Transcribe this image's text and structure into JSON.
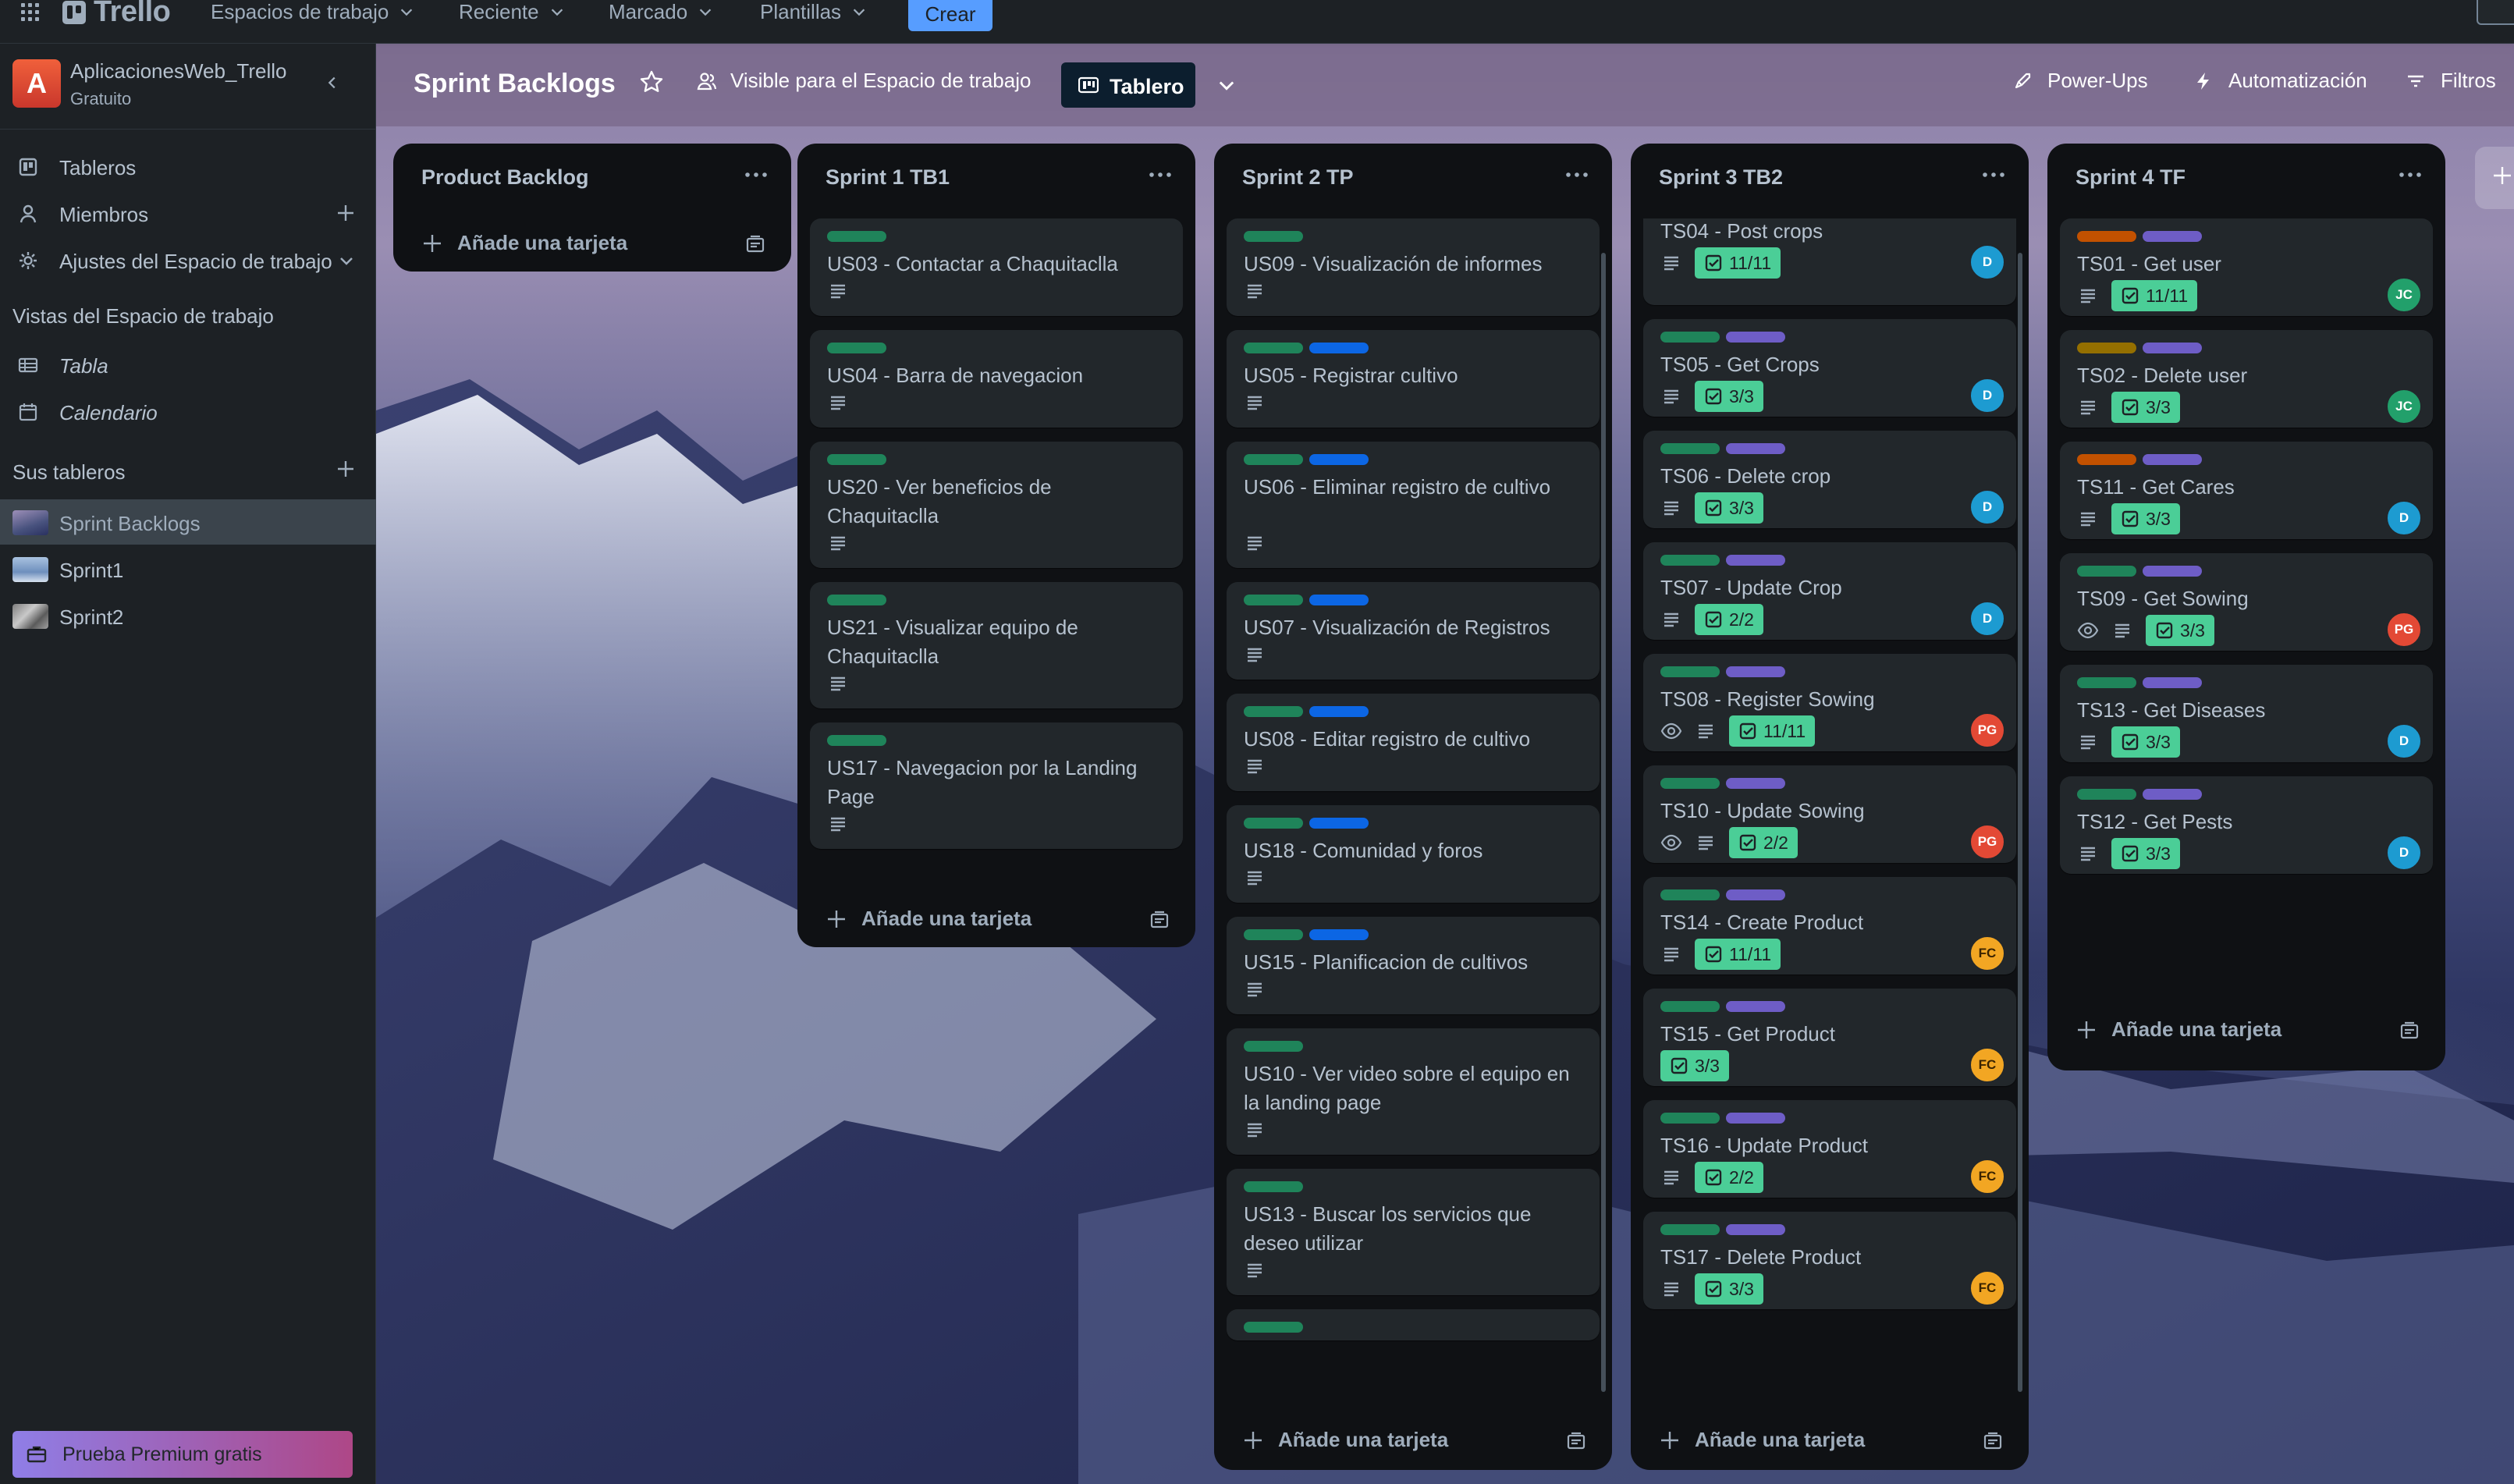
{
  "topbar": {
    "app_name": "Trello",
    "menus": [
      "Espacios de trabajo",
      "Reciente",
      "Marcado",
      "Plantillas"
    ],
    "create_label": "Crear"
  },
  "sidebar": {
    "workspace_initial": "A",
    "workspace_name": "AplicacionesWeb_Trello",
    "workspace_plan": "Gratuito",
    "items": [
      {
        "label": "Tableros",
        "icon": "board-icon"
      },
      {
        "label": "Miembros",
        "icon": "person-icon"
      },
      {
        "label": "Ajustes del Espacio de trabajo",
        "icon": "gear-icon"
      }
    ],
    "views_heading": "Vistas del Espacio de trabajo",
    "views": [
      {
        "label": "Tabla",
        "icon": "table-icon"
      },
      {
        "label": "Calendario",
        "icon": "calendar-icon"
      }
    ],
    "boards_heading": "Sus tableros",
    "boards": [
      {
        "label": "Sprint Backlogs",
        "active": true
      },
      {
        "label": "Sprint1",
        "active": false
      },
      {
        "label": "Sprint2",
        "active": false
      }
    ],
    "premium_label": "Prueba Premium gratis"
  },
  "board": {
    "title": "Sprint Backlogs",
    "visibility_label": "Visible para el Espacio de trabajo",
    "view_label": "Tablero",
    "powerups_label": "Power-Ups",
    "automation_label": "Automatización",
    "filters_label": "Filtros",
    "add_card_label": "Añade una tarjeta",
    "colors": {
      "label_green": "#1f845a",
      "label_blue": "#0c66e4",
      "label_purple": "#6e5dc6",
      "label_orange": "#c25100",
      "label_yellow": "#946f00",
      "checklist_complete": "#4bce97",
      "list_bg": "#0f1114",
      "card_bg": "#22272b"
    }
  },
  "lists": [
    {
      "title": "Product Backlog",
      "cards": []
    },
    {
      "title": "Sprint 1 TB1",
      "cards": [
        {
          "title": "US03 - Contactar a Chaquitaclla",
          "labels": [
            "green"
          ],
          "description": true
        },
        {
          "title": "US04 - Barra de navegacion",
          "labels": [
            "green"
          ],
          "description": true
        },
        {
          "title": "US20 - Ver beneficios de Chaquitaclla",
          "labels": [
            "green"
          ],
          "description": true
        },
        {
          "title": "US21 - Visualizar equipo de Chaquitaclla",
          "labels": [
            "green"
          ],
          "description": true
        },
        {
          "title": "US17 - Navegacion por la Landing Page",
          "labels": [
            "green"
          ],
          "description": true
        }
      ]
    },
    {
      "title": "Sprint 2 TP",
      "cards": [
        {
          "title": "US09 - Visualización de informes",
          "labels": [
            "green"
          ],
          "description": true
        },
        {
          "title": "US05 - Registrar cultivo",
          "labels": [
            "green",
            "blue"
          ],
          "description": true
        },
        {
          "title": "US06 - Eliminar registro de cultivo",
          "labels": [
            "green",
            "blue"
          ],
          "description": true
        },
        {
          "title": "US07 - Visualización de Registros",
          "labels": [
            "green",
            "blue"
          ],
          "description": true
        },
        {
          "title": "US08 - Editar registro de cultivo",
          "labels": [
            "green",
            "blue"
          ],
          "description": true
        },
        {
          "title": "US18 - Comunidad y foros",
          "labels": [
            "green",
            "blue"
          ],
          "description": true
        },
        {
          "title": "US15 - Planificacion de cultivos",
          "labels": [
            "green",
            "blue"
          ],
          "description": true
        },
        {
          "title": "US10 - Ver video sobre el equipo en la landing page",
          "labels": [
            "green"
          ],
          "description": true
        },
        {
          "title": "US13 - Buscar los servicios que deseo utilizar",
          "labels": [
            "green"
          ],
          "description": true
        },
        {
          "title": "",
          "labels": [
            "green"
          ],
          "description": false
        }
      ]
    },
    {
      "title": "Sprint 3 TB2",
      "cards": [
        {
          "title": "TS04 - Post crops",
          "labels": [],
          "description": true,
          "checklist": "11/11",
          "member": "D"
        },
        {
          "title": "TS05 - Get Crops",
          "labels": [
            "green",
            "purple"
          ],
          "description": true,
          "checklist": "3/3",
          "member": "D"
        },
        {
          "title": "TS06 - Delete crop",
          "labels": [
            "green",
            "purple"
          ],
          "description": true,
          "checklist": "3/3",
          "member": "D"
        },
        {
          "title": "TS07 - Update Crop",
          "labels": [
            "green",
            "purple"
          ],
          "description": true,
          "checklist": "2/2",
          "member": "D"
        },
        {
          "title": "TS08 - Register Sowing",
          "labels": [
            "green",
            "purple"
          ],
          "watch": true,
          "description": true,
          "checklist": "11/11",
          "member": "PG"
        },
        {
          "title": "TS10 - Update Sowing",
          "labels": [
            "green",
            "purple"
          ],
          "watch": true,
          "description": true,
          "checklist": "2/2",
          "member": "PG"
        },
        {
          "title": "TS14 - Create Product",
          "labels": [
            "green",
            "purple"
          ],
          "description": true,
          "checklist": "11/11",
          "member": "FC"
        },
        {
          "title": "TS15 - Get Product",
          "labels": [
            "green",
            "purple"
          ],
          "description": false,
          "checklist": "3/3",
          "member": "FC"
        },
        {
          "title": "TS16 - Update Product",
          "labels": [
            "green",
            "purple"
          ],
          "description": true,
          "checklist": "2/2",
          "member": "FC"
        },
        {
          "title": "TS17 - Delete Product",
          "labels": [
            "green",
            "purple"
          ],
          "description": true,
          "checklist": "3/3",
          "member": "FC"
        }
      ]
    },
    {
      "title": "Sprint 4 TF",
      "cards": [
        {
          "title": "TS01 - Get user",
          "labels": [
            "orange",
            "purple"
          ],
          "description": true,
          "checklist": "11/11",
          "member": "JC"
        },
        {
          "title": "TS02 - Delete user",
          "labels": [
            "yellow",
            "purple"
          ],
          "description": true,
          "checklist": "3/3",
          "member": "JC"
        },
        {
          "title": "TS11 - Get Cares",
          "labels": [
            "orange",
            "purple"
          ],
          "description": true,
          "checklist": "3/3",
          "member": "D"
        },
        {
          "title": "TS09 - Get Sowing",
          "labels": [
            "green",
            "purple"
          ],
          "watch": true,
          "description": true,
          "checklist": "3/3",
          "member": "PG"
        },
        {
          "title": "TS13 - Get Diseases",
          "labels": [
            "green",
            "purple"
          ],
          "description": true,
          "checklist": "3/3",
          "member": "D"
        },
        {
          "title": "TS12 - Get Pests",
          "labels": [
            "green",
            "purple"
          ],
          "description": true,
          "checklist": "3/3",
          "member": "D"
        }
      ]
    }
  ]
}
